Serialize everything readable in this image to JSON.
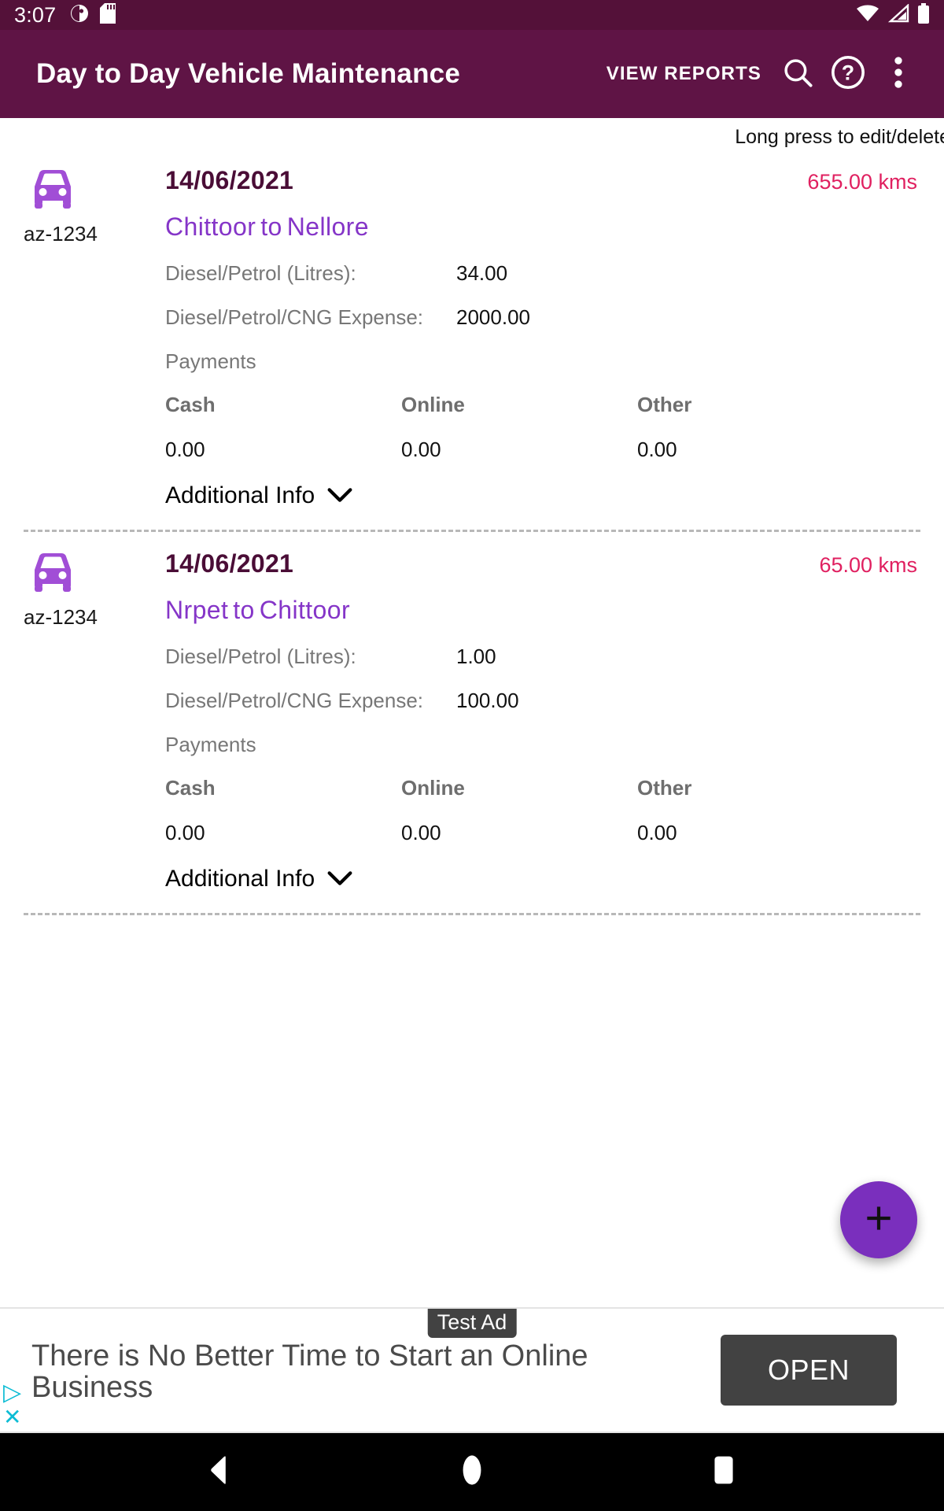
{
  "status_bar": {
    "time": "3:07",
    "left_icons": [
      "do-not-disturb-icon",
      "sd-card-icon"
    ],
    "right_icons": [
      "wifi-icon",
      "cellular-signal-icon",
      "battery-icon"
    ]
  },
  "app_bar": {
    "title": "Day to Day Vehicle Maintenance",
    "view_reports_label": "VIEW REPORTS",
    "actions": [
      "search-icon",
      "help-icon",
      "overflow-menu-icon"
    ],
    "background_color": "#5f1445"
  },
  "content": {
    "hint": "Long press to edit/delete",
    "trips": [
      {
        "vehicle": "az-1234",
        "date": "14/06/2021",
        "distance": "655.00 kms",
        "from": "Chittoor",
        "to_label": "to",
        "to": "Nellore",
        "details": [
          {
            "label": "Diesel/Petrol (Litres):",
            "value": "34.00"
          },
          {
            "label": "Diesel/Petrol/CNG Expense:",
            "value": "2000.00"
          }
        ],
        "payments_label": "Payments",
        "payments": [
          {
            "head": "Cash",
            "value": "0.00"
          },
          {
            "head": "Online",
            "value": "0.00"
          },
          {
            "head": "Other",
            "value": "0.00"
          }
        ],
        "additional_info_label": "Additional Info"
      },
      {
        "vehicle": "az-1234",
        "date": "14/06/2021",
        "distance": "65.00 kms",
        "from": "Nrpet",
        "to_label": "to",
        "to": "Chittoor",
        "details": [
          {
            "label": "Diesel/Petrol (Litres):",
            "value": "1.00"
          },
          {
            "label": "Diesel/Petrol/CNG Expense:",
            "value": "100.00"
          }
        ],
        "payments_label": "Payments",
        "payments": [
          {
            "head": "Cash",
            "value": "0.00"
          },
          {
            "head": "Online",
            "value": "0.00"
          },
          {
            "head": "Other",
            "value": "0.00"
          }
        ],
        "additional_info_label": "Additional Info"
      }
    ]
  },
  "fab": {
    "icon": "plus-icon",
    "color": "#7a2fbd"
  },
  "ad": {
    "badge": "Test Ad",
    "text": "There is No Better Time to Start an Online Business",
    "open_label": "OPEN",
    "adchoices_icon": "adchoices-triangle-icon",
    "close_icon": "close-icon"
  },
  "nav_bar": {
    "buttons": [
      "back-icon",
      "home-icon",
      "recents-icon"
    ]
  },
  "colors": {
    "app_bar": "#5f1445",
    "status_bar": "#541139",
    "accent_purple": "#8535c8",
    "date_purple": "#4a0d36",
    "kms_pink": "#e02060",
    "fab_purple": "#7a2fbd"
  }
}
